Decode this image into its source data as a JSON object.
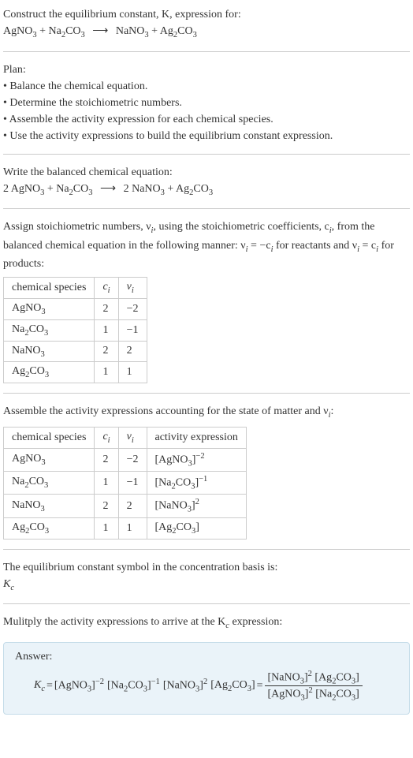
{
  "header": {
    "prompt_line1": "Construct the equilibrium constant, K, expression for:",
    "equation_lhs1": "AgNO",
    "equation_lhs1_sub": "3",
    "plus1": " + ",
    "equation_lhs2": "Na",
    "equation_lhs2_sub1": "2",
    "equation_lhs2_mid": "CO",
    "equation_lhs2_sub2": "3",
    "arrow": "⟶",
    "equation_rhs1": "NaNO",
    "equation_rhs1_sub": "3",
    "plus2": " + ",
    "equation_rhs2": "Ag",
    "equation_rhs2_sub1": "2",
    "equation_rhs2_mid": "CO",
    "equation_rhs2_sub2": "3"
  },
  "plan": {
    "title": "Plan:",
    "b1": "• Balance the chemical equation.",
    "b2": "• Determine the stoichiometric numbers.",
    "b3": "• Assemble the activity expression for each chemical species.",
    "b4": "• Use the activity expressions to build the equilibrium constant expression."
  },
  "balanced": {
    "title": "Write the balanced chemical equation:",
    "c1": "2 AgNO",
    "c1_sub": "3",
    "plus1": " + ",
    "c2": "Na",
    "c2_sub1": "2",
    "c2_mid": "CO",
    "c2_sub2": "3",
    "arrow": "⟶",
    "c3": "2 NaNO",
    "c3_sub": "3",
    "plus2": " + ",
    "c4": "Ag",
    "c4_sub1": "2",
    "c4_mid": "CO",
    "c4_sub2": "3"
  },
  "stoich": {
    "intro1": "Assign stoichiometric numbers, ν",
    "intro1_sub": "i",
    "intro2": ", using the stoichiometric coefficients, c",
    "intro2_sub": "i",
    "intro3": ", from the balanced chemical equation in the following manner: ν",
    "intro3_sub": "i",
    "intro4": " = −c",
    "intro4_sub": "i",
    "intro5": " for reactants and ν",
    "intro5_sub": "i",
    "intro6": " = c",
    "intro6_sub": "i",
    "intro7": " for products:",
    "th1": "chemical species",
    "th2": "c",
    "th2_sub": "i",
    "th3": "ν",
    "th3_sub": "i",
    "r1_sp": "AgNO",
    "r1_sp_sub": "3",
    "r1_c": "2",
    "r1_v": "−2",
    "r2_sp": "Na",
    "r2_sp_sub1": "2",
    "r2_sp_mid": "CO",
    "r2_sp_sub2": "3",
    "r2_c": "1",
    "r2_v": "−1",
    "r3_sp": "NaNO",
    "r3_sp_sub": "3",
    "r3_c": "2",
    "r3_v": "2",
    "r4_sp": "Ag",
    "r4_sp_sub1": "2",
    "r4_sp_mid": "CO",
    "r4_sp_sub2": "3",
    "r4_c": "1",
    "r4_v": "1"
  },
  "activity": {
    "intro1": "Assemble the activity expressions accounting for the state of matter and ν",
    "intro1_sub": "i",
    "intro2": ":",
    "th1": "chemical species",
    "th2": "c",
    "th2_sub": "i",
    "th3": "ν",
    "th3_sub": "i",
    "th4": "activity expression",
    "r1_sp": "AgNO",
    "r1_sp_sub": "3",
    "r1_c": "2",
    "r1_v": "−2",
    "r1_ex_l": "[AgNO",
    "r1_ex_sub": "3",
    "r1_ex_r": "]",
    "r1_ex_sup": "−2",
    "r2_sp": "Na",
    "r2_sp_sub1": "2",
    "r2_sp_mid": "CO",
    "r2_sp_sub2": "3",
    "r2_c": "1",
    "r2_v": "−1",
    "r2_ex_l": "[Na",
    "r2_ex_sub1": "2",
    "r2_ex_mid": "CO",
    "r2_ex_sub2": "3",
    "r2_ex_r": "]",
    "r2_ex_sup": "−1",
    "r3_sp": "NaNO",
    "r3_sp_sub": "3",
    "r3_c": "2",
    "r3_v": "2",
    "r3_ex_l": "[NaNO",
    "r3_ex_sub": "3",
    "r3_ex_r": "]",
    "r3_ex_sup": "2",
    "r4_sp": "Ag",
    "r4_sp_sub1": "2",
    "r4_sp_mid": "CO",
    "r4_sp_sub2": "3",
    "r4_c": "1",
    "r4_v": "1",
    "r4_ex_l": "[Ag",
    "r4_ex_sub1": "2",
    "r4_ex_mid": "CO",
    "r4_ex_sub2": "3",
    "r4_ex_r": "]"
  },
  "ksymbol": {
    "line1": "The equilibrium constant symbol in the concentration basis is:",
    "sym": "K",
    "sym_sub": "c"
  },
  "multiply": {
    "line1": "Mulitply the activity expressions to arrive at the K",
    "line1_sub": "c",
    "line2": " expression:"
  },
  "answer": {
    "label": "Answer:",
    "kc": "K",
    "kc_sub": "c",
    "eq": " = ",
    "t1_l": "[AgNO",
    "t1_sub": "3",
    "t1_r": "]",
    "t1_sup": "−2",
    "sp1": " ",
    "t2_l": "[Na",
    "t2_sub1": "2",
    "t2_mid": "CO",
    "t2_sub2": "3",
    "t2_r": "]",
    "t2_sup": "−1",
    "sp2": " ",
    "t3_l": "[NaNO",
    "t3_sub": "3",
    "t3_r": "]",
    "t3_sup": "2",
    "sp3": " ",
    "t4_l": "[Ag",
    "t4_sub1": "2",
    "t4_mid": "CO",
    "t4_sub2": "3",
    "t4_r": "]",
    "eq2": " = ",
    "num1_l": "[NaNO",
    "num1_sub": "3",
    "num1_r": "]",
    "num1_sup": "2",
    "num_sp": " ",
    "num2_l": "[Ag",
    "num2_sub1": "2",
    "num2_mid": "CO",
    "num2_sub2": "3",
    "num2_r": "]",
    "den1_l": "[AgNO",
    "den1_sub": "3",
    "den1_r": "]",
    "den1_sup": "2",
    "den_sp": " ",
    "den2_l": "[Na",
    "den2_sub1": "2",
    "den2_mid": "CO",
    "den2_sub2": "3",
    "den2_r": "]"
  }
}
